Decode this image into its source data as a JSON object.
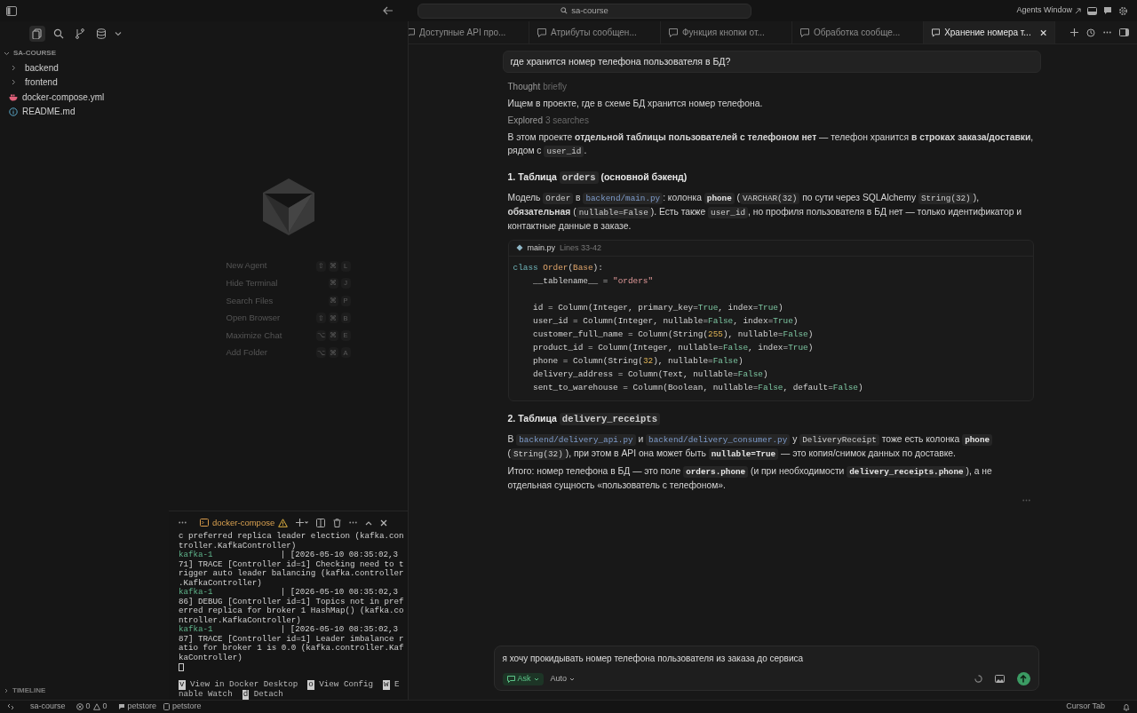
{
  "title_bar": {
    "search": "sa-course",
    "agents_window": "Agents Window"
  },
  "sidebar": {
    "views": [
      {
        "kind": "files",
        "selected": true
      },
      {
        "kind": "search",
        "selected": false
      },
      {
        "kind": "branch",
        "selected": false
      },
      {
        "kind": "database",
        "selected": false
      }
    ],
    "root": {
      "label": "SA-COURSE",
      "expanded": true
    },
    "tree": [
      {
        "kind": "folder",
        "label": "backend",
        "expanded": false
      },
      {
        "kind": "folder",
        "label": "frontend",
        "expanded": false
      },
      {
        "kind": "docker",
        "label": "docker-compose.yml"
      },
      {
        "kind": "info",
        "label": "README.md"
      }
    ],
    "timeline": "TIMELINE"
  },
  "empty_state": {
    "shortcuts": [
      {
        "label": "New Agent",
        "keys": [
          "⇧",
          "⌘",
          "L"
        ]
      },
      {
        "label": "Hide Terminal",
        "keys": [
          "⌘",
          "J"
        ]
      },
      {
        "label": "Search Files",
        "keys": [
          "⌘",
          "P"
        ]
      },
      {
        "label": "Open Browser",
        "keys": [
          "⇧",
          "⌘",
          "B"
        ]
      },
      {
        "label": "Maximize Chat",
        "keys": [
          "⌥",
          "⌘",
          "E"
        ]
      },
      {
        "label": "Add Folder",
        "keys": [
          "⌥",
          "⌘",
          "A"
        ]
      }
    ]
  },
  "terminal": {
    "tab": "docker-compose",
    "warning": true,
    "cursor": true,
    "lines": [
      {
        "text": "c preferred replica leader election (kafka.con"
      },
      {
        "text": "troller.KafkaController)"
      },
      {
        "service": "kafka-1",
        "text": "| [2026-05-10 08:35:02,3"
      },
      {
        "text": "71] TRACE [Controller id=1] Checking need to t"
      },
      {
        "text": "rigger auto leader balancing (kafka.controller"
      },
      {
        "text": ".KafkaController)"
      },
      {
        "service": "kafka-1",
        "text": "| [2026-05-10 08:35:02,3"
      },
      {
        "text": "86] DEBUG [Controller id=1] Topics not in pref"
      },
      {
        "text": "erred replica for broker 1 HashMap() (kafka.co"
      },
      {
        "text": "ntroller.KafkaController)"
      },
      {
        "service": "kafka-1",
        "text": "| [2026-05-10 08:35:02,3"
      },
      {
        "text": "87] TRACE [Controller id=1] Leader imbalance r"
      },
      {
        "text": "atio for broker 1 is 0.0 (kafka.controller.Kaf"
      },
      {
        "text": "kaController)"
      }
    ],
    "footer": [
      [
        {
          "key": "v",
          "label": "View in Docker Desktop"
        },
        {
          "key": "o",
          "label": "View Config"
        },
        {
          "key": "w",
          "label": "E"
        }
      ],
      [
        {
          "label": "nable Watch"
        },
        {
          "key": "d",
          "label": "Detach"
        }
      ]
    ]
  },
  "tabs": [
    {
      "label": "Доступные API про...",
      "selected": false
    },
    {
      "label": "Атрибуты сообщен...",
      "selected": false
    },
    {
      "label": "Функция кнопки от...",
      "selected": false
    },
    {
      "label": "Обработка сообще...",
      "selected": false
    },
    {
      "label": "Хранение номера т...",
      "selected": true
    }
  ],
  "chat": {
    "user_message": "где хранится номер телефона пользователя в БД?",
    "blocks": [
      {
        "kind": "status",
        "label": "Thought",
        "detail": "briefly"
      },
      {
        "kind": "paragraph",
        "parts": [
          {
            "kind": "text",
            "text": "Ищем в проекте, где в схеме БД хранится номер телефона."
          }
        ]
      },
      {
        "kind": "status",
        "label": "Explored",
        "detail": "3 searches"
      },
      {
        "kind": "paragraph",
        "parts": [
          {
            "kind": "text",
            "text": "В этом проекте **отдельной таблицы пользователей с телефоном нет** — телефон хранится **в строках заказа/доставки**, рядом с "
          },
          {
            "kind": "code",
            "text": "user_id"
          },
          {
            "kind": "text",
            "text": "."
          }
        ]
      },
      {
        "kind": "heading",
        "parts": [
          {
            "kind": "text",
            "text": "1. Таблица "
          },
          {
            "kind": "code",
            "text": "orders"
          },
          {
            "kind": "text",
            "text": " (основной бэкенд)"
          }
        ]
      },
      {
        "kind": "paragraph",
        "parts": [
          {
            "kind": "text",
            "text": "Модель "
          },
          {
            "kind": "code",
            "text": "Order"
          },
          {
            "kind": "text",
            "text": " в "
          },
          {
            "kind": "link",
            "text": "backend/main.py"
          },
          {
            "kind": "text",
            "text": ": колонка "
          },
          {
            "kind": "code_bold",
            "text": "phone"
          },
          {
            "kind": "text",
            "text": " ("
          },
          {
            "kind": "code",
            "text": "VARCHAR(32)"
          },
          {
            "kind": "text",
            "text": " по сути через SQLAlchemy "
          },
          {
            "kind": "code",
            "text": "String(32)"
          },
          {
            "kind": "text",
            "text": "), **обязательная** ("
          },
          {
            "kind": "code",
            "text": "nullable=False"
          },
          {
            "kind": "text",
            "text": "). Есть также "
          },
          {
            "kind": "code",
            "text": "user_id"
          },
          {
            "kind": "text",
            "text": ", но профиля пользователя в БД нет — только идентификатор и контактные данные в заказе."
          }
        ]
      },
      {
        "kind": "code",
        "file": "main.py",
        "range": "Lines 33-42",
        "groups": [
          [
            "class Order(Base):",
            "    __tablename__ = \"orders\""
          ],
          [
            "    id = Column(Integer, primary_key=True, index=True)",
            "    user_id = Column(Integer, nullable=False, index=True)",
            "    customer_full_name = Column(String(255), nullable=False)",
            "    product_id = Column(Integer, nullable=False, index=True)",
            "    phone = Column(String(32), nullable=False)",
            "    delivery_address = Column(Text, nullable=False)",
            "    sent_to_warehouse = Column(Boolean, nullable=False, default=False)"
          ]
        ]
      },
      {
        "kind": "heading",
        "parts": [
          {
            "kind": "text",
            "text": "2. Таблица "
          },
          {
            "kind": "code",
            "text": "delivery_receipts"
          }
        ]
      },
      {
        "kind": "paragraph",
        "parts": [
          {
            "kind": "text",
            "text": "В "
          },
          {
            "kind": "link",
            "text": "backend/delivery_api.py"
          },
          {
            "kind": "text",
            "text": " и "
          },
          {
            "kind": "link",
            "text": "backend/delivery_consumer.py"
          },
          {
            "kind": "text",
            "text": " у "
          },
          {
            "kind": "code",
            "text": "DeliveryReceipt"
          },
          {
            "kind": "text",
            "text": " тоже есть колонка "
          },
          {
            "kind": "code_bold",
            "text": "phone"
          },
          {
            "kind": "text",
            "text": " ("
          },
          {
            "kind": "code",
            "text": "String(32)"
          },
          {
            "kind": "text",
            "text": "), при этом в API она может быть "
          },
          {
            "kind": "code_bold",
            "text": "nullable=True"
          },
          {
            "kind": "text",
            "text": " — это копия/снимок данных по доставке."
          }
        ]
      },
      {
        "kind": "paragraph",
        "parts": [
          {
            "kind": "text",
            "text": "Итого: номер телефона в БД — это поле "
          },
          {
            "kind": "code_bold",
            "text": "orders.phone"
          },
          {
            "kind": "text",
            "text": " (и при необходимости "
          },
          {
            "kind": "code_bold",
            "text": "delivery_receipts.phone"
          },
          {
            "kind": "text",
            "text": "), а не отдельная сущность «пользователь с телефоном»."
          }
        ]
      }
    ]
  },
  "composer": {
    "value": "я хочу прокидывать номер телефона пользователя из заказа до сервиса",
    "mode": "Ask",
    "model": "Auto"
  },
  "status_bar": {
    "project": "sa-course",
    "errors": "0",
    "warnings": "0",
    "branch": "petstore",
    "env": "petstore",
    "right": "Cursor Tab"
  }
}
